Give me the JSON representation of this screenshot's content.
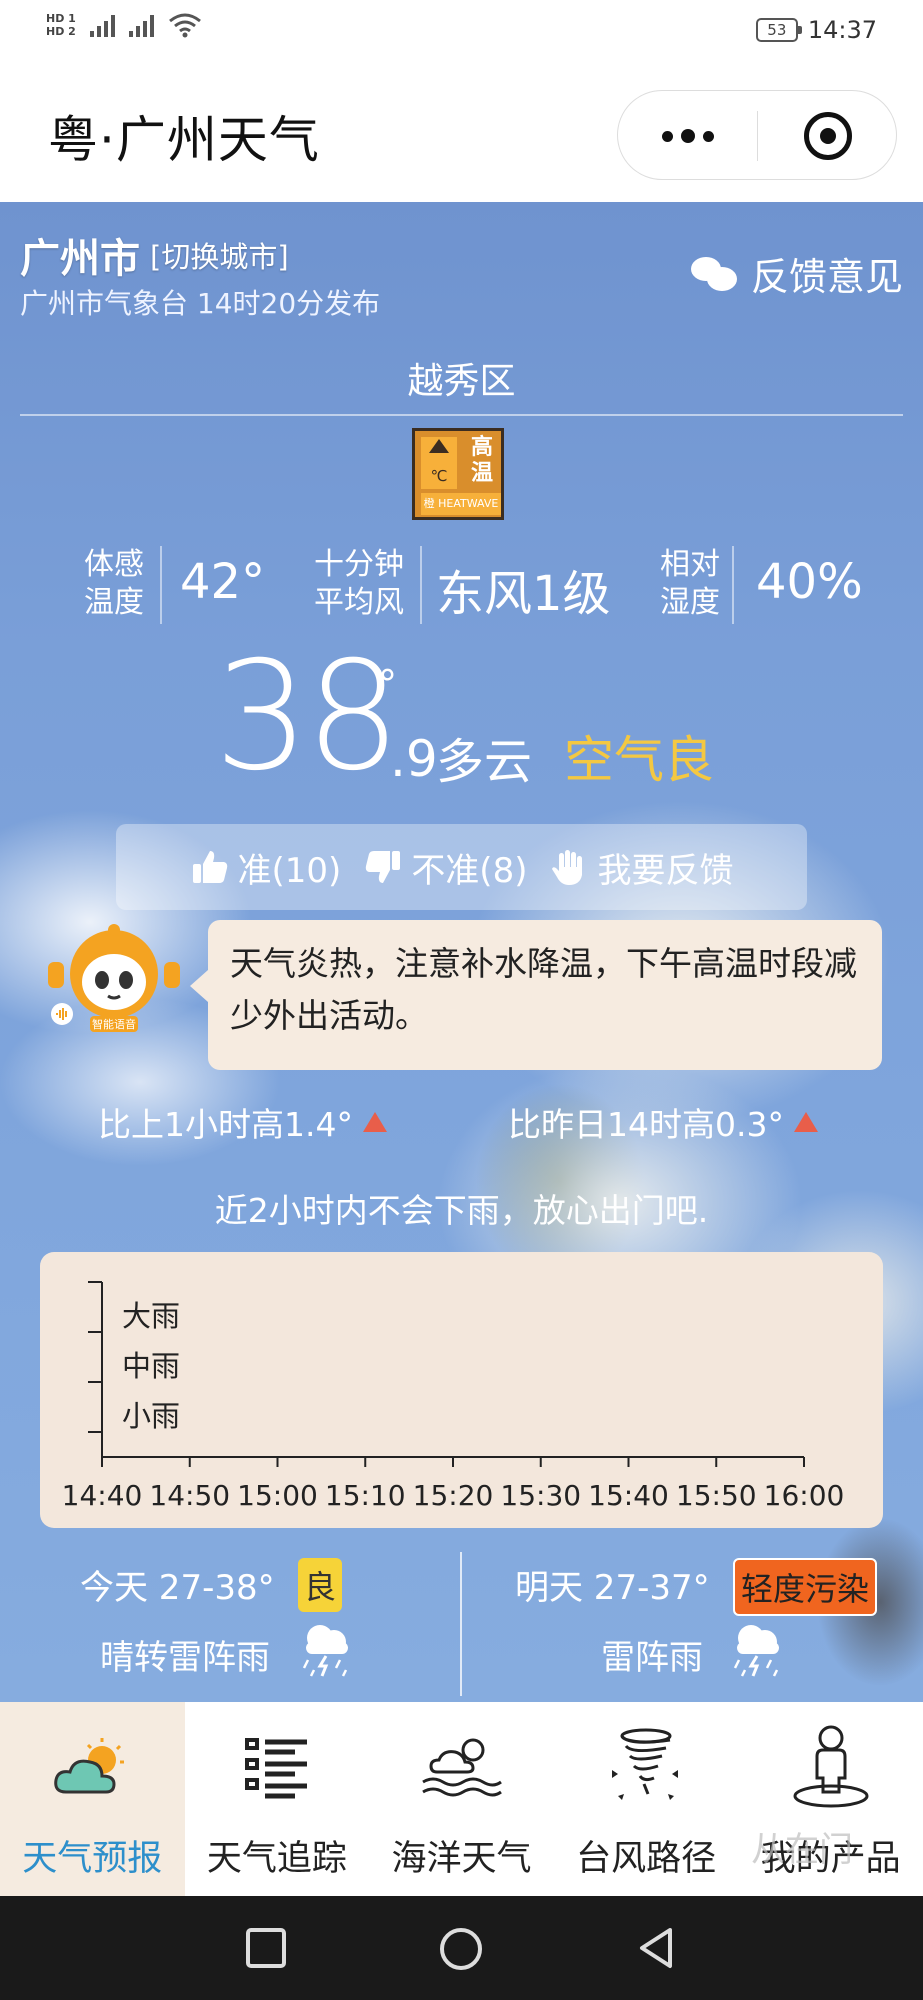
{
  "status_bar": {
    "sim1": "HD 1",
    "sim2": "HD 2",
    "battery": "53",
    "time": "14:37"
  },
  "header": {
    "title": "粤·广州天气"
  },
  "location": {
    "city": "广州市",
    "switch_city": "[切换城市]",
    "publish_info": "广州市气象台 14时20分发布",
    "feedback": "反馈意见",
    "district": "越秀区"
  },
  "warning": {
    "icon": "heat-warning-icon",
    "level_char": "橙",
    "line1": "高",
    "line2": "温",
    "badge": "HEATWAVE",
    "unit": "℃",
    "color": "#f7b03a"
  },
  "metrics": {
    "feels_label_1": "体感",
    "feels_label_2": "温度",
    "feels_value": "42°",
    "wind_label_1": "十分钟",
    "wind_label_2": "平均风",
    "wind_value": "东风1级",
    "humidity_label_1": "相对",
    "humidity_label_2": "湿度",
    "humidity_value": "40%"
  },
  "current": {
    "temp_int": "38",
    "degree": "°",
    "temp_dec": ".9",
    "condition": "多云",
    "air_quality": "空气良",
    "air_quality_color": "#f4c842"
  },
  "votes": {
    "accurate": "准(10)",
    "inaccurate": "不准(8)",
    "feedback": "我要反馈"
  },
  "assistant": {
    "label": "智能语音",
    "message": "天气炎热，注意补水降温，下午高温时段减少外出活动。"
  },
  "changes": {
    "vs_last_hour": "比上1小时高1.4°",
    "vs_yesterday": "比昨日14时高0.3°",
    "trend_color": "#e85e4a"
  },
  "rain_note": "近2小时内不会下雨，放心出门吧.",
  "chart_data": {
    "type": "line",
    "title": "",
    "y_categories": [
      "小雨",
      "中雨",
      "大雨"
    ],
    "x": [
      "14:40",
      "14:50",
      "15:00",
      "15:10",
      "15:20",
      "15:30",
      "15:40",
      "15:50",
      "16:00"
    ],
    "series": [
      {
        "values": [
          0,
          0,
          0,
          0,
          0,
          0,
          0,
          0,
          0
        ]
      }
    ],
    "grid": false
  },
  "forecast": {
    "today": {
      "title": "今天 27-38°",
      "aqi": "良",
      "condition": "晴转雷阵雨",
      "icon": "thunderstorm-icon",
      "aqi_color": "#f6d338"
    },
    "tomorrow": {
      "title": "明天 27-37°",
      "aqi": "轻度污染",
      "condition": "雷阵雨",
      "icon": "thunderstorm-icon",
      "aqi_color": "#f0651f"
    }
  },
  "tabbar": {
    "tabs": [
      {
        "label": "天气预报",
        "icon": "weather-forecast-icon",
        "active": true
      },
      {
        "label": "天气追踪",
        "icon": "list-icon",
        "active": false
      },
      {
        "label": "海洋天气",
        "icon": "ocean-weather-icon",
        "active": false
      },
      {
        "label": "台风路径",
        "icon": "typhoon-icon",
        "active": false
      },
      {
        "label": "我的产品",
        "icon": "user-icon",
        "active": false
      }
    ],
    "active_color": "#2d8fcb"
  },
  "watermark": "从在门"
}
